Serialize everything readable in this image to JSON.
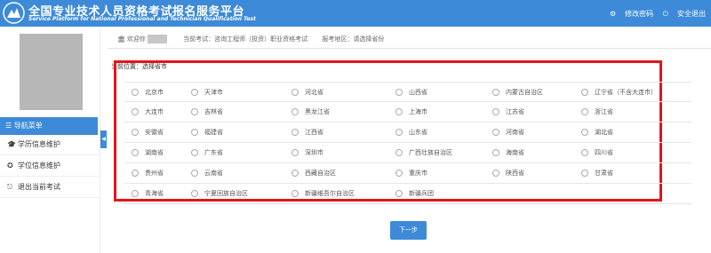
{
  "header": {
    "title_cn": "全国专业技术人员资格考试报名服务平台",
    "title_en": "Service Platform for National Professional and Technician Qualification Test",
    "change_password": "修改密码",
    "logout": "安全退出"
  },
  "sidebar": {
    "menu_header": "导航菜单",
    "items": [
      {
        "label": "学历信息维护",
        "icon": "graduation-cap-icon"
      },
      {
        "label": "学位信息维护",
        "icon": "badge-icon"
      },
      {
        "label": "退出当前考试",
        "icon": "exit-icon"
      }
    ]
  },
  "infobar": {
    "welcome": "欢迎你",
    "exam_label": "当前考试：",
    "exam_value": "咨询工程师（投资）职业资格考试",
    "region_label": "报考地区：",
    "region_value": "请选择省份"
  },
  "location": "当前位置：选择省市",
  "provinces": [
    [
      "北京市",
      "天津市",
      "河北省",
      "山西省",
      "内蒙古自治区",
      "辽宁省（不含大连市）"
    ],
    [
      "大连市",
      "吉林省",
      "黑龙江省",
      "上海市",
      "江苏省",
      "浙江省"
    ],
    [
      "安徽省",
      "福建省",
      "江西省",
      "山东省",
      "河南省",
      "湖北省"
    ],
    [
      "湖南省",
      "广东省",
      "深圳市",
      "广西壮族自治区",
      "海南省",
      "四川省"
    ],
    [
      "贵州省",
      "云南省",
      "西藏自治区",
      "重庆市",
      "陕西省",
      "甘肃省"
    ],
    [
      "青海省",
      "宁夏回族自治区",
      "新疆维吾尔自治区",
      "新疆兵团"
    ]
  ],
  "next_button": "下一步",
  "colors": {
    "brand": "#3d8ad8",
    "highlight_border": "#e4141b"
  }
}
